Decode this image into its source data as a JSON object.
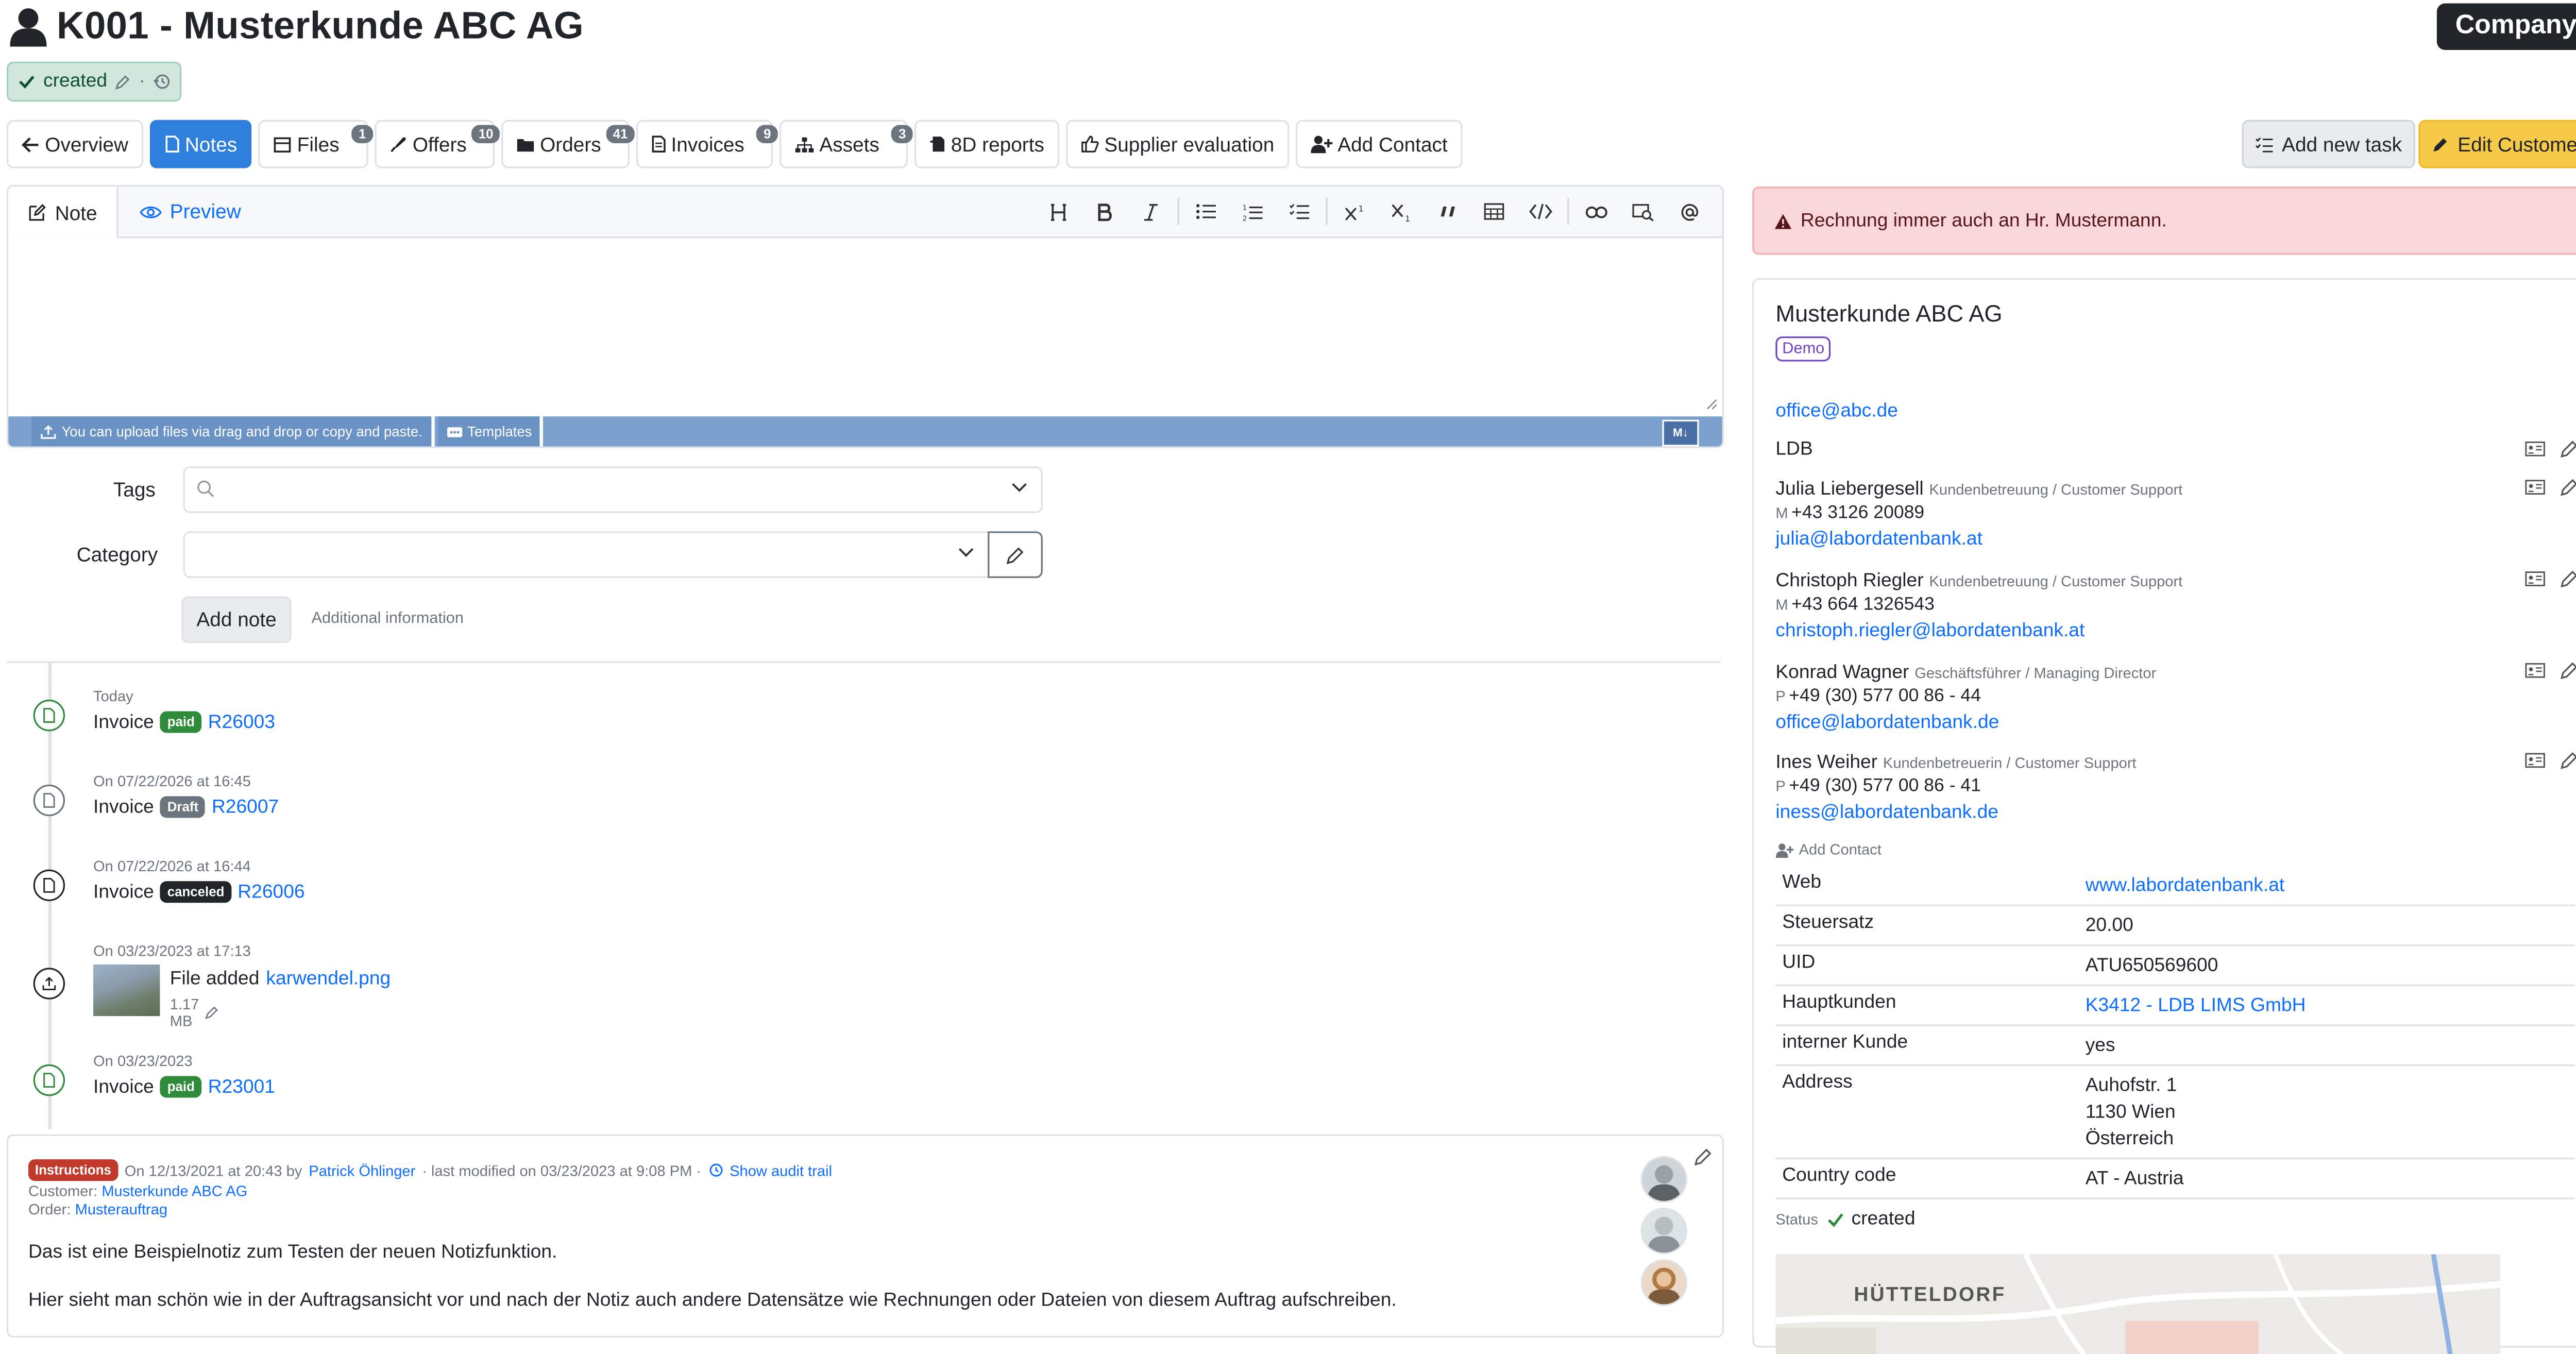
{
  "header": {
    "title": "K001 - Musterkunde ABC AG",
    "type_badge": "Company",
    "state": "created",
    "state_sep": "·"
  },
  "tabs": [
    {
      "label": "Overview",
      "icon": "arrow-left-icon"
    },
    {
      "label": "Notes",
      "icon": "file-icon",
      "active": true
    },
    {
      "label": "Files",
      "icon": "files-icon",
      "count": "1"
    },
    {
      "label": "Offers",
      "icon": "rocket-icon",
      "count": "10"
    },
    {
      "label": "Orders",
      "icon": "folder-icon",
      "count": "41"
    },
    {
      "label": "Invoices",
      "icon": "invoice-icon",
      "count": "9"
    },
    {
      "label": "Assets",
      "icon": "sitemap-icon",
      "count": "3"
    },
    {
      "label": "8D reports",
      "icon": "report-icon"
    },
    {
      "label": "Supplier evaluation",
      "icon": "thumbs-up-icon"
    },
    {
      "label": "Add Contact",
      "icon": "user-plus-icon"
    }
  ],
  "actions": {
    "add_task": "Add new task",
    "edit_customer": "Edit Customer"
  },
  "editor": {
    "tab_note": "Note",
    "tab_preview": "Preview",
    "upload_hint": "You can upload files via drag and drop or copy and paste.",
    "templates": "Templates",
    "md_badge": "M↓"
  },
  "form": {
    "tags_label": "Tags",
    "category_label": "Category",
    "add_note": "Add note",
    "additional_info": "Additional information"
  },
  "timeline": [
    {
      "date": "Today",
      "type": "Invoice",
      "status": "paid",
      "link": "R26003",
      "color": "#2e8b3a"
    },
    {
      "date": "On 07/22/2026 at 16:45",
      "type": "Invoice",
      "status": "Draft",
      "link": "R26007",
      "color": "#6c757d"
    },
    {
      "date": "On 07/22/2026 at 16:44",
      "type": "Invoice",
      "status": "canceled",
      "link": "R26006",
      "color": "#212529"
    },
    {
      "date": "On 03/23/2023 at 17:13",
      "type": "File added",
      "link": "karwendel.png",
      "size": "1.17 MB",
      "color": "#212529"
    },
    {
      "date": "On 03/23/2023",
      "type": "Invoice",
      "status": "paid",
      "link": "R23001",
      "color": "#2e8b3a"
    }
  ],
  "note_card": {
    "badge": "Instructions",
    "created": "On 12/13/2021 at 20:43 by",
    "author": "Patrick Öhlinger",
    "modified": "· last modified on 03/23/2023 at 9:08 PM ·",
    "audit": "Show audit trail",
    "customer_label": "Customer:",
    "customer": "Musterkunde ABC AG",
    "order_label": "Order:",
    "order": "Musterauftrag",
    "p1": "Das ist eine Beispielnotiz zum Testen der neuen Notizfunktion.",
    "p2": "Hier sieht man schön wie in der Auftragsansicht vor und nach der Notiz auch andere Datensätze wie Rechnungen oder Dateien von diesem Auftrag aufschreiben."
  },
  "alert": "Rechnung immer auch an Hr. Mustermann.",
  "customer": {
    "name": "Musterkunde ABC AG",
    "tag": "Demo",
    "email": "office@abc.de",
    "group": "LDB",
    "contacts": [
      {
        "name": "Julia Liebergesell",
        "role": "Kundenbetreuung / Customer Support",
        "phone_label": "M",
        "phone": "+43 3126 20089",
        "email": "julia@labordatenbank.at"
      },
      {
        "name": "Christoph Riegler",
        "role": "Kundenbetreuung / Customer Support",
        "phone_label": "M",
        "phone": "+43 664 1326543",
        "email": "christoph.riegler@labordatenbank.at"
      },
      {
        "name": "Konrad Wagner",
        "role": "Geschäftsführer / Managing Director",
        "phone_label": "P",
        "phone": "+49 (30) 577 00 86 - 44",
        "email": "office@labordatenbank.de"
      },
      {
        "name": "Ines Weiher",
        "role": "Kundenbetreuerin / Customer Support",
        "phone_label": "P",
        "phone": "+49 (30) 577 00 86 - 41",
        "email": "iness@labordatenbank.de"
      }
    ],
    "add_contact": "Add Contact",
    "props": [
      {
        "key": "Web",
        "value": "www.labordatenbank.at",
        "link": true
      },
      {
        "key": "Steuersatz",
        "value": "20.00"
      },
      {
        "key": "UID",
        "value": "ATU650569600"
      },
      {
        "key": "Hauptkunden",
        "value": "K3412 - LDB LIMS GmbH",
        "link": true
      },
      {
        "key": "interner Kunde",
        "value": "yes"
      },
      {
        "key": "Address",
        "lines": [
          "Auhofstr. 1",
          "1130 Wien",
          "Österreich"
        ]
      },
      {
        "key": "Country code",
        "value": "AT - Austria"
      }
    ],
    "status_label": "Status",
    "status": "created",
    "map_label": "HÜTTELDORF"
  },
  "colors": {
    "primary": "#2f7fdc",
    "edit": "#f7c948",
    "paid": "#2e8b3a",
    "alert_bg": "#f8d7da",
    "instructions": "#c0392b"
  }
}
